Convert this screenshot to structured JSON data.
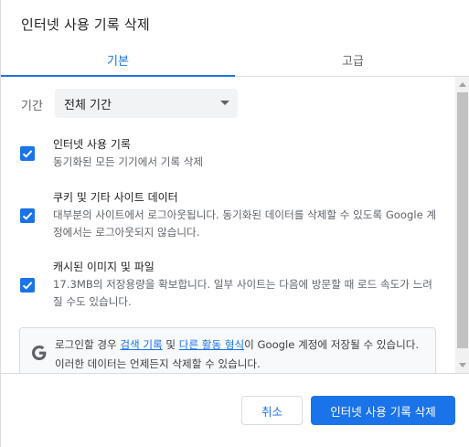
{
  "dialog": {
    "title": "인터넷 사용 기록 삭제"
  },
  "tabs": [
    {
      "label": "기본",
      "selected": true
    },
    {
      "label": "고급",
      "selected": false
    }
  ],
  "time_range": {
    "label": "기간",
    "value": "전체 기간"
  },
  "options": [
    {
      "title": "인터넷 사용 기록",
      "description": "동기화된 모든 기기에서 기록 삭제",
      "checked": true
    },
    {
      "title": "쿠키 및 기타 사이트 데이터",
      "description": "대부분의 사이트에서 로그아웃됩니다. 동기화된 데이터를 삭제할 수 있도록 Google 계정에서는 로그아웃되지 않습니다.",
      "checked": true
    },
    {
      "title": "캐시된 이미지 및 파일",
      "description": "17.3MB의 저장용량을 확보합니다. 일부 사이트는 다음에 방문할 때 로드 속도가 느려질 수도 있습니다.",
      "checked": true
    }
  ],
  "signin_notice": {
    "text_1": "로그인할 경우 ",
    "link_1": "검색 기록",
    "text_2": " 및 ",
    "link_2": "다른 활동 형식",
    "text_3": "이 Google 계정에 저장될 수 있습니다. 이러한 데이터는 언제든지 삭제할 수 있습니다."
  },
  "buttons": {
    "cancel": "취소",
    "clear": "인터넷 사용 기록 삭제"
  },
  "colors": {
    "accent": "#1a73e8",
    "text": "#202124",
    "secondary_text": "#5f6368",
    "divider": "#dadce0"
  }
}
